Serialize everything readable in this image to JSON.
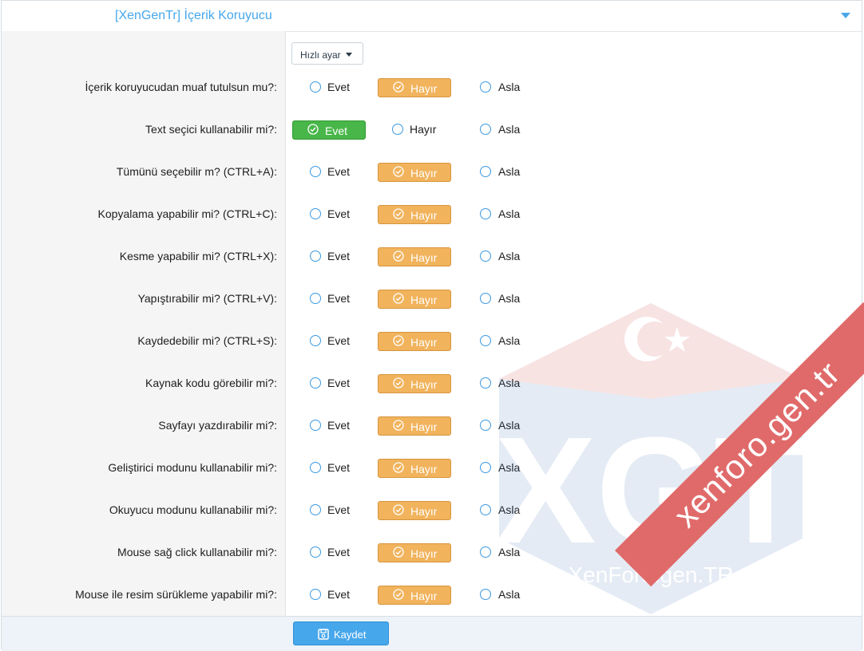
{
  "header": {
    "title": "[XenGenTr] İçerik Koruyucu"
  },
  "quick_settings": {
    "label": "Hızlı ayar"
  },
  "options": {
    "yes": "Evet",
    "no": "Hayır",
    "never": "Asla"
  },
  "rows": [
    {
      "label": "İçerik koruyucudan muaf tutulsun mu?:",
      "selected": "no"
    },
    {
      "label": "Text seçici kullanabilir mi?:",
      "selected": "yes"
    },
    {
      "label": "Tümünü seçebilir m? (CTRL+A):",
      "selected": "no"
    },
    {
      "label": "Kopyalama yapabilir mi? (CTRL+C):",
      "selected": "no"
    },
    {
      "label": "Kesme yapabilir mi? (CTRL+X):",
      "selected": "no"
    },
    {
      "label": "Yapıştırabilir mi? (CTRL+V):",
      "selected": "no"
    },
    {
      "label": "Kaydedebilir mi? (CTRL+S):",
      "selected": "no"
    },
    {
      "label": "Kaynak kodu görebilir mi?:",
      "selected": "no"
    },
    {
      "label": "Sayfayı yazdırabilir mi?:",
      "selected": "no"
    },
    {
      "label": "Geliştirici modunu kullanabilir mi?:",
      "selected": "no"
    },
    {
      "label": "Okuyucu modunu kullanabilir mi?:",
      "selected": "no"
    },
    {
      "label": "Mouse sağ click kullanabilir mi?:",
      "selected": "no"
    },
    {
      "label": "Mouse ile resim sürükleme yapabilir mi?:",
      "selected": "no"
    }
  ],
  "footer": {
    "save_label": "Kaydet",
    "save_icon": "save-icon"
  },
  "watermark": {
    "logo_text": "XGT",
    "logo_subtext": "XenForo.gen.TR",
    "ribbon_text": "xenforo.gen.tr"
  },
  "colors": {
    "accent": "#47a7eb",
    "selected_no": "#f1b35c",
    "selected_yes": "#48b649",
    "ribbon": "#e06a6a"
  }
}
